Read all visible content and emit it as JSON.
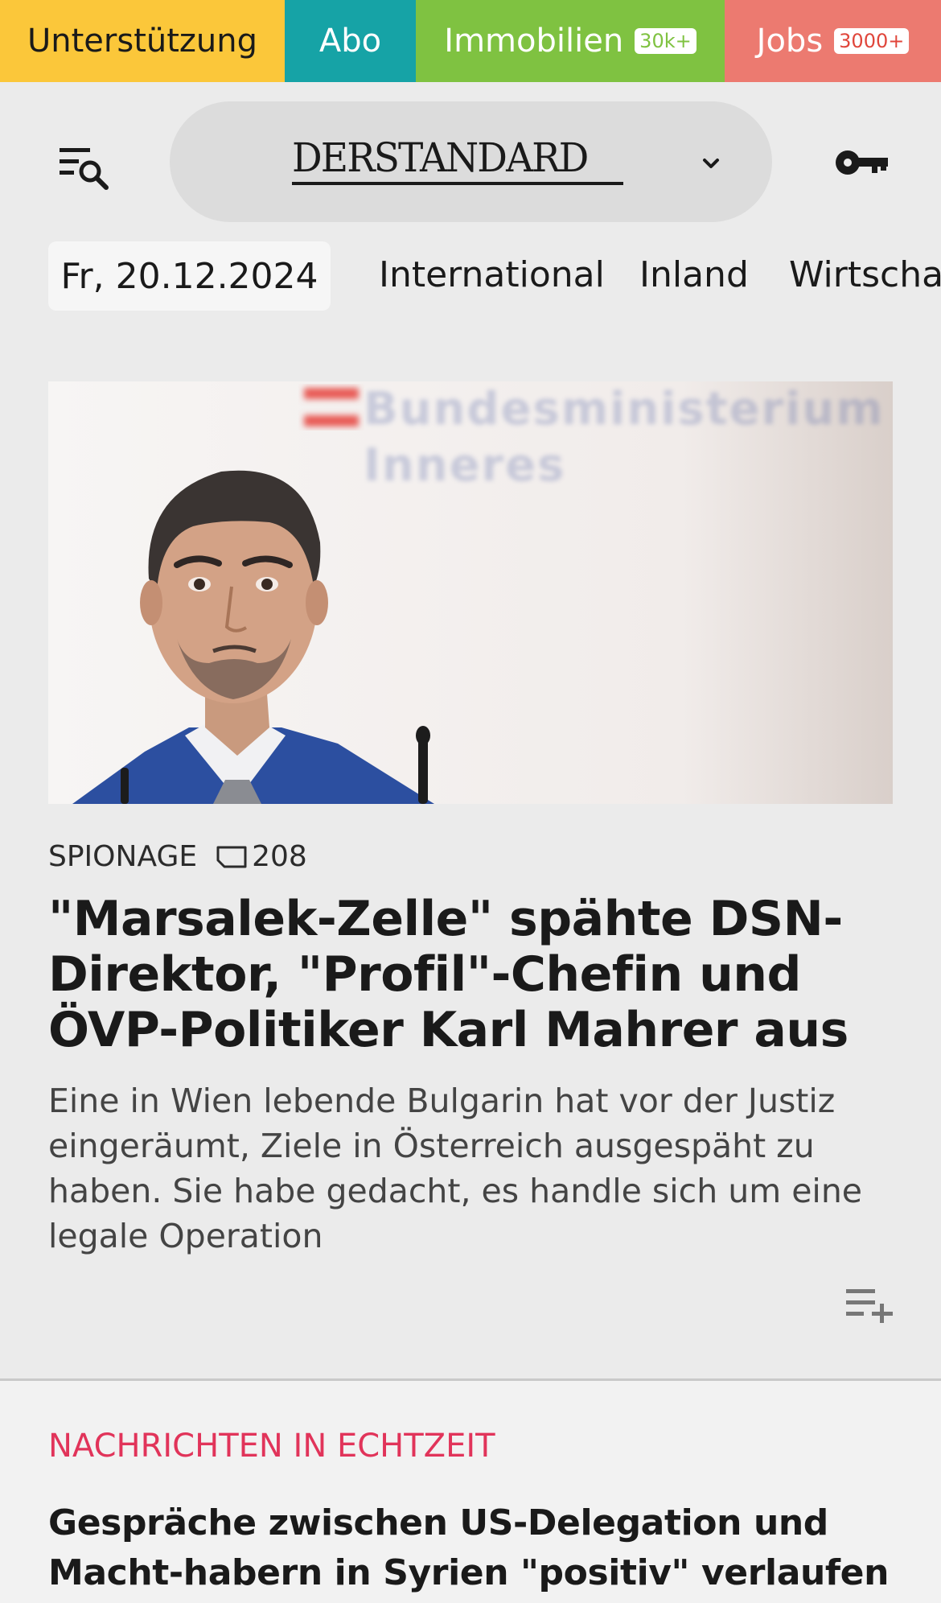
{
  "topbar": {
    "support_label": "Unterstützung",
    "abo_label": "Abo",
    "immobilien_label": "Immobilien",
    "immobilien_badge": "30k+",
    "jobs_label": "Jobs",
    "jobs_badge": "3000+"
  },
  "header": {
    "logo": "DERSTANDARD",
    "menu_icon": "menu-search-icon",
    "account_icon": "key-icon"
  },
  "nav": {
    "date": "Fr, 20.12.2024",
    "items": [
      "International",
      "Inland",
      "Wirtschaft"
    ]
  },
  "article": {
    "kicker": "SPIONAGE",
    "comments": "208",
    "headline": "\"Marsalek-Zelle\" spähte DSN-Direktor, \"Profil\"-Chefin und ÖVP-Politiker Karl Mahrer aus",
    "lead": "Eine in Wien lebende Bulgarin hat vor der Justiz eingeräumt, Ziele in Österreich ausgespäht zu haben. Sie habe gedacht, es handle sich um eine legale Operation",
    "image_sign_line1": "Bundesministerium",
    "image_sign_line2": "Inneres"
  },
  "live": {
    "label": "NACHRICHTEN IN ECHTZEIT",
    "headline": "Gespräche zwischen US-Delegation und Macht-habern in Syrien \"positiv\" verlaufen"
  },
  "colors": {
    "support": "#fbc73a",
    "abo": "#16a3a6",
    "immobilien": "#7fc241",
    "jobs": "#ec7a70",
    "live_accent": "#e1345a"
  }
}
